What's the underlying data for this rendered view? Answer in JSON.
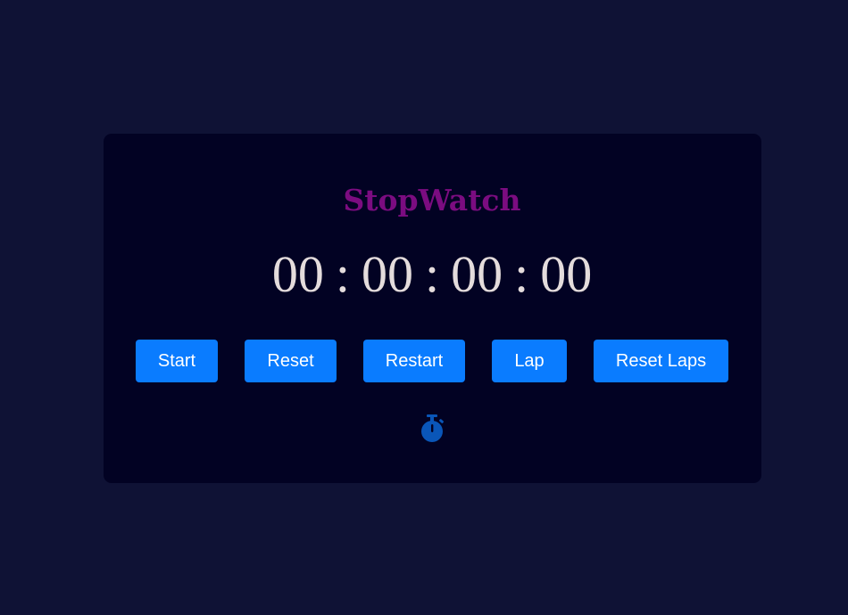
{
  "app": {
    "title": "StopWatch"
  },
  "display": {
    "hours": "00",
    "minutes": "00",
    "seconds": "00",
    "centiseconds": "00",
    "separator": ":"
  },
  "buttons": {
    "start": "Start",
    "reset": "Reset",
    "restart": "Restart",
    "lap": "Lap",
    "reset_laps": "Reset Laps"
  },
  "icons": {
    "stopwatch": "stopwatch-icon"
  },
  "colors": {
    "page_background": "#0f1235",
    "card_background": "#020223",
    "title": "#7b0c80",
    "time": "#e4dcdc",
    "button": "#0a7cff",
    "icon": "#0a56b8"
  }
}
